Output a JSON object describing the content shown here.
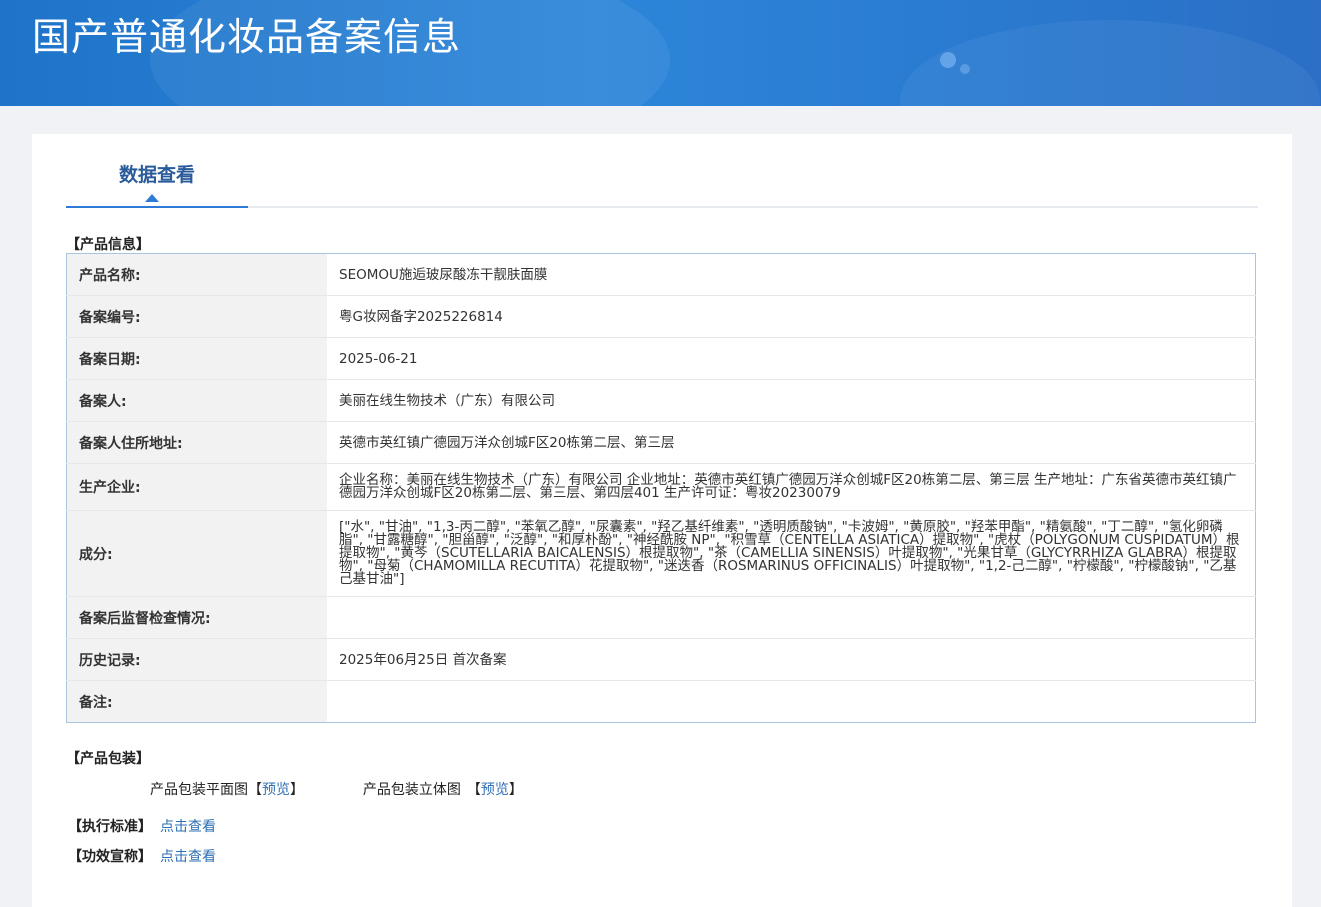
{
  "header": {
    "title": "国产普通化妆品备案信息"
  },
  "tabs": [
    {
      "label": "数据查看"
    }
  ],
  "product_info": {
    "section_label": "【产品信息】",
    "rows": [
      {
        "key": "产品名称:",
        "value": "SEOMOU施逅玻尿酸冻干靓肤面膜"
      },
      {
        "key": "备案编号:",
        "value": "粤G妆网备字2025226814"
      },
      {
        "key": "备案日期:",
        "value": "2025-06-21"
      },
      {
        "key": "备案人:",
        "value": "美丽在线生物技术（广东）有限公司"
      },
      {
        "key": "备案人住所地址:",
        "value": "英德市英红镇广德园万洋众创城F区20栋第二层、第三层"
      },
      {
        "key": "生产企业:",
        "value": "企业名称：美丽在线生物技术（广东）有限公司 企业地址：英德市英红镇广德园万洋众创城F区20栋第二层、第三层 生产地址：广东省英德市英红镇广德园万洋众创城F区20栋第二层、第三层、第四层401 生产许可证：粤妆20230079"
      },
      {
        "key": "成分:",
        "value": "[\"水\", \"甘油\", \"1,3-丙二醇\", \"苯氧乙醇\", \"尿囊素\", \"羟乙基纤维素\", \"透明质酸钠\", \"卡波姆\", \"黄原胶\", \"羟苯甲酯\", \"精氨酸\", \"丁二醇\", \"氢化卵磷脂\", \"甘露糖醇\", \"胆甾醇\", \"泛醇\", \"和厚朴酚\", \"神经酰胺 NP\", \"积雪草（CENTELLA ASIATICA）提取物\", \"虎杖（POLYGONUM CUSPIDATUM）根提取物\", \"黄芩（SCUTELLARIA BAICALENSIS）根提取物\", \"茶（CAMELLIA SINENSIS）叶提取物\", \"光果甘草（GLYCYRRHIZA GLABRA）根提取物\", \"母菊（CHAMOMILLA RECUTITA）花提取物\", \"迷迭香（ROSMARINUS OFFICINALIS）叶提取物\", \"1,2-己二醇\", \"柠檬酸\", \"柠檬酸钠\", \"乙基己基甘油\"]"
      },
      {
        "key": "备案后监督检查情况:",
        "value": ""
      },
      {
        "key": "历史记录:",
        "value": "2025年06月25日 首次备案"
      },
      {
        "key": "备注:",
        "value": ""
      }
    ]
  },
  "packaging": {
    "section_label": "【产品包装】",
    "flat_label": "产品包装平面图",
    "stereo_label": "产品包装立体图",
    "bracket_open": "【",
    "bracket_close": "】",
    "preview_link": "预览"
  },
  "standard": {
    "label": "【执行标准】",
    "link": "点击查看"
  },
  "efficacy": {
    "label": "【功效宣称】",
    "link": "点击查看"
  }
}
